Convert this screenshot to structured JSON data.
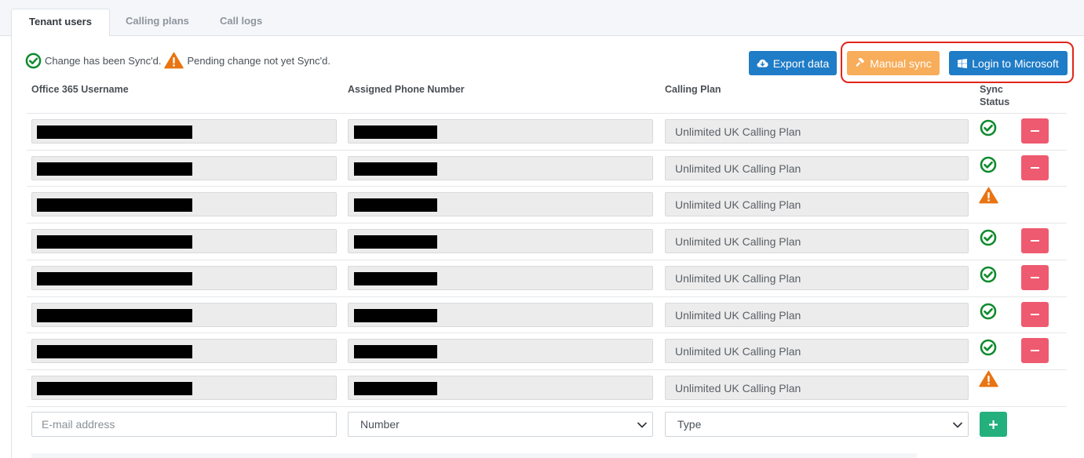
{
  "tabs": [
    {
      "label": "Tenant users",
      "active": true
    },
    {
      "label": "Calling plans",
      "active": false
    },
    {
      "label": "Call logs",
      "active": false
    }
  ],
  "legend": {
    "synced_text": "Change has been Sync'd.",
    "pending_text": "Pending change not yet Sync'd."
  },
  "toolbar": {
    "export_label": "Export data",
    "manual_sync_label": "Manual sync",
    "login_label": "Login to Microsoft"
  },
  "columns": {
    "username": "Office 365 Username",
    "phone": "Assigned Phone Number",
    "plan": "Calling Plan",
    "sync_status_line1": "Sync",
    "sync_status_line2": "Status"
  },
  "rows": [
    {
      "username": "",
      "phone": "",
      "plan": "Unlimited UK Calling Plan",
      "status": "synced",
      "removable": true
    },
    {
      "username": "",
      "phone": "",
      "plan": "Unlimited UK Calling Plan",
      "status": "synced",
      "removable": true
    },
    {
      "username": "",
      "phone": "",
      "plan": "Unlimited UK Calling Plan",
      "status": "pending",
      "removable": false
    },
    {
      "username": "",
      "phone": "",
      "plan": "Unlimited UK Calling Plan",
      "status": "synced",
      "removable": true
    },
    {
      "username": "",
      "phone": "",
      "plan": "Unlimited UK Calling Plan",
      "status": "synced",
      "removable": true
    },
    {
      "username": "",
      "phone": "",
      "plan": "Unlimited UK Calling Plan",
      "status": "synced",
      "removable": true
    },
    {
      "username": "",
      "phone": "",
      "plan": "Unlimited UK Calling Plan",
      "status": "synced",
      "removable": true
    },
    {
      "username": "",
      "phone": "",
      "plan": "Unlimited UK Calling Plan",
      "status": "pending",
      "removable": false
    }
  ],
  "new_row": {
    "email_placeholder": "E-mail address",
    "number_selected": "Number",
    "type_selected": "Type"
  },
  "colors": {
    "primary": "#1f7cc7",
    "warning_button": "#f7ad5a",
    "danger": "#ee5a6f",
    "success": "#23b07d",
    "synced_icon": "#0d8a2c",
    "pending_icon": "#e87412",
    "highlight": "#e0251b"
  },
  "icons": {
    "synced": "check-circle-icon",
    "pending": "warning-triangle-icon",
    "export": "cloud-download-icon",
    "manual_sync": "hammer-icon",
    "login": "windows-logo-icon",
    "remove": "minus-icon",
    "add": "plus-icon"
  }
}
